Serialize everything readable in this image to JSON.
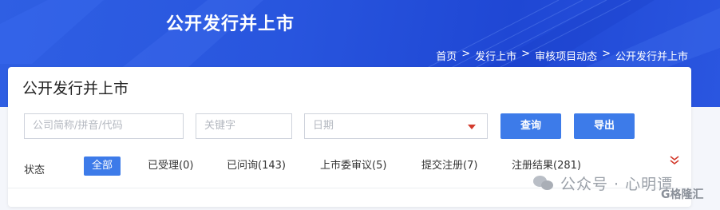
{
  "header": {
    "title": "公开发行并上市",
    "breadcrumb": [
      "首页",
      "发行上市",
      "审核项目动态",
      "公开发行并上市"
    ],
    "breadcrumb_sep": ">"
  },
  "card": {
    "title": "公开发行并上市",
    "filters": {
      "company_placeholder": "公司简称/拼音/代码",
      "keyword_placeholder": "关键字",
      "date_placeholder": "日期"
    },
    "buttons": {
      "query": "查询",
      "export": "导出"
    },
    "status": {
      "label": "状态",
      "tabs": [
        {
          "label": "全部",
          "active": true
        },
        {
          "label": "已受理(0)"
        },
        {
          "label": "已问询(143)"
        },
        {
          "label": "上市委审议(5)"
        },
        {
          "label": "提交注册(7)"
        },
        {
          "label": "注册结果(281)"
        }
      ]
    }
  },
  "watermark": {
    "text": "公众号 · 心明谭",
    "corner": "G格隆汇"
  },
  "colors": {
    "banner": "#2855de",
    "accent": "#3d7be9",
    "caret": "#d33a2c"
  },
  "icons": {
    "expand": "double-chevron-down-icon",
    "date_caret": "caret-down-icon",
    "watermark": "wechat-icon"
  }
}
